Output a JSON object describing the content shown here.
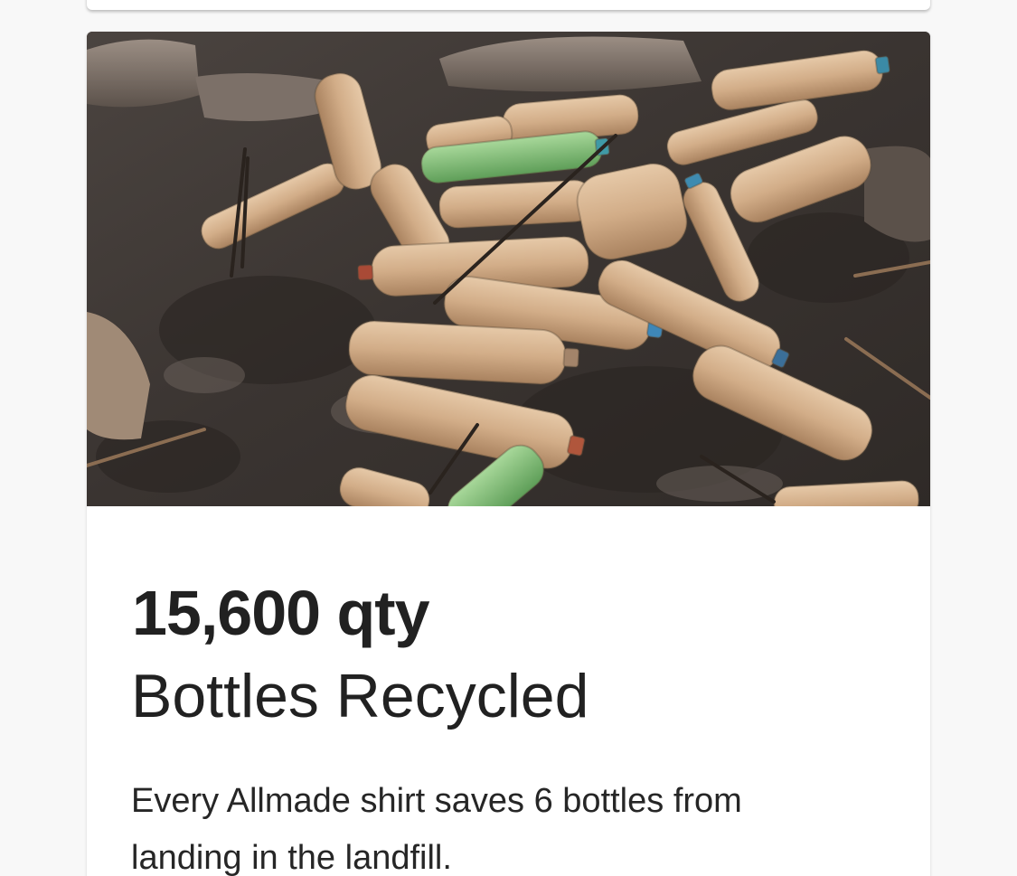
{
  "card": {
    "image": {
      "subject": "Discarded plastic bottles on dirt ground"
    },
    "stat_value": "15,600 qty",
    "stat_label": "Bottles Recycled",
    "description": "Every Allmade shirt saves 6 bottles from landing in the landfill."
  },
  "colors": {
    "page_background": "#f8f8f8",
    "card_background": "#ffffff",
    "text_primary": "#212121"
  }
}
